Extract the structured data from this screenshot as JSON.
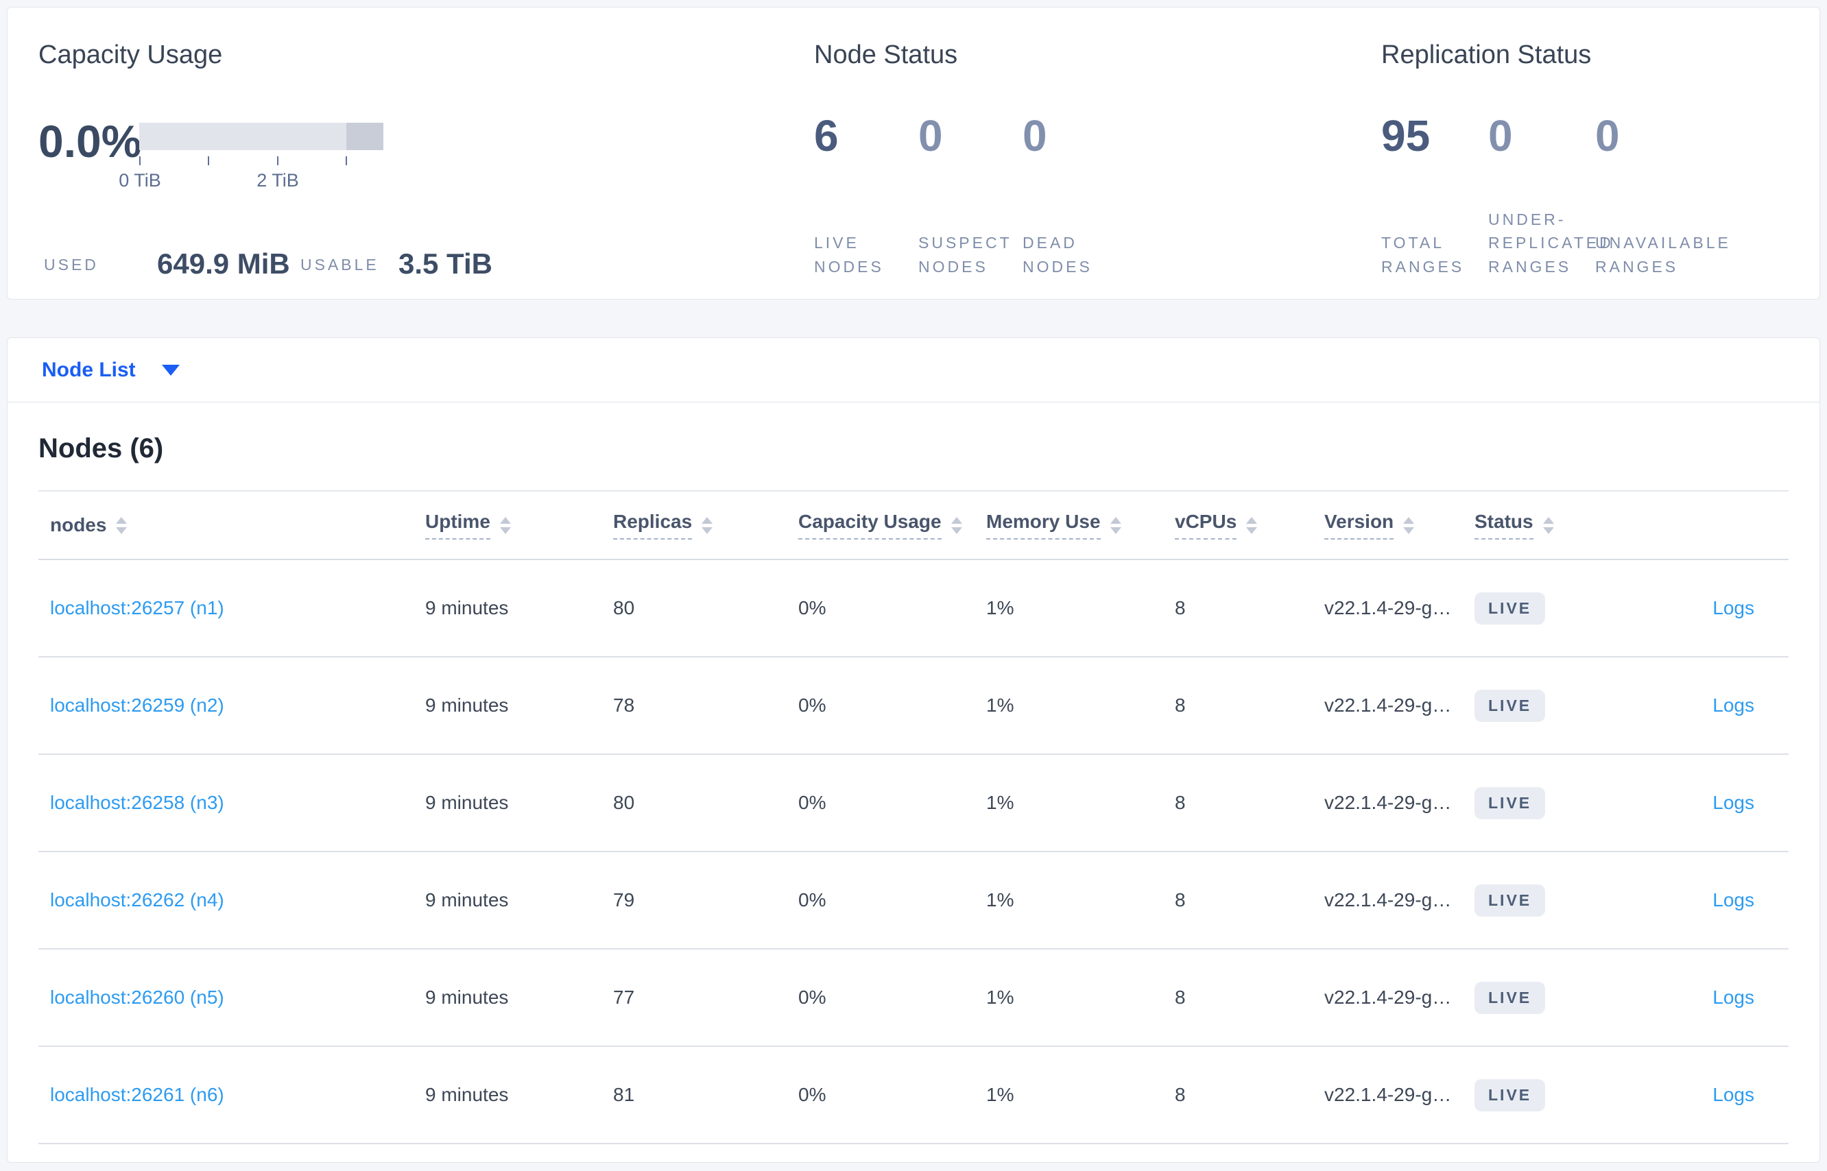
{
  "summary": {
    "capacity": {
      "title": "Capacity Usage",
      "percent": "0.0%",
      "axis_ticks": [
        "0 TiB",
        "2 TiB"
      ],
      "used_label": "USED",
      "used_value": "649.9 MiB",
      "usable_label": "USABLE",
      "usable_value": "3.5 TiB"
    },
    "node_status": {
      "title": "Node Status",
      "metrics": [
        {
          "value": "6",
          "lines": [
            "LIVE",
            "NODES"
          ]
        },
        {
          "value": "0",
          "lines": [
            "SUSPECT",
            "NODES"
          ]
        },
        {
          "value": "0",
          "lines": [
            "DEAD",
            "NODES"
          ]
        }
      ]
    },
    "replication": {
      "title": "Replication Status",
      "metrics": [
        {
          "value": "95",
          "lines": [
            "TOTAL",
            "RANGES"
          ]
        },
        {
          "value": "0",
          "lines": [
            "UNDER-",
            "REPLICATED",
            "RANGES"
          ]
        },
        {
          "value": "0",
          "lines": [
            "UNAVAILABLE",
            "RANGES"
          ]
        }
      ]
    }
  },
  "node_list_dropdown": {
    "label": "Node List"
  },
  "table": {
    "title": "Nodes (6)",
    "columns": [
      {
        "label": "nodes"
      },
      {
        "label": "Uptime"
      },
      {
        "label": "Replicas"
      },
      {
        "label": "Capacity Usage"
      },
      {
        "label": "Memory Use"
      },
      {
        "label": "vCPUs"
      },
      {
        "label": "Version"
      },
      {
        "label": "Status"
      }
    ],
    "logs_label": "Logs",
    "rows": [
      {
        "node": "localhost:26257 (n1)",
        "uptime": "9 minutes",
        "replicas": "80",
        "capacity": "0%",
        "memory": "1%",
        "vcpus": "8",
        "version": "v22.1.4-29-g…",
        "status": "LIVE"
      },
      {
        "node": "localhost:26259 (n2)",
        "uptime": "9 minutes",
        "replicas": "78",
        "capacity": "0%",
        "memory": "1%",
        "vcpus": "8",
        "version": "v22.1.4-29-g…",
        "status": "LIVE"
      },
      {
        "node": "localhost:26258 (n3)",
        "uptime": "9 minutes",
        "replicas": "80",
        "capacity": "0%",
        "memory": "1%",
        "vcpus": "8",
        "version": "v22.1.4-29-g…",
        "status": "LIVE"
      },
      {
        "node": "localhost:26262 (n4)",
        "uptime": "9 minutes",
        "replicas": "79",
        "capacity": "0%",
        "memory": "1%",
        "vcpus": "8",
        "version": "v22.1.4-29-g…",
        "status": "LIVE"
      },
      {
        "node": "localhost:26260 (n5)",
        "uptime": "9 minutes",
        "replicas": "77",
        "capacity": "0%",
        "memory": "1%",
        "vcpus": "8",
        "version": "v22.1.4-29-g…",
        "status": "LIVE"
      },
      {
        "node": "localhost:26261 (n6)",
        "uptime": "9 minutes",
        "replicas": "81",
        "capacity": "0%",
        "memory": "1%",
        "vcpus": "8",
        "version": "v22.1.4-29-g…",
        "status": "LIVE"
      }
    ]
  }
}
